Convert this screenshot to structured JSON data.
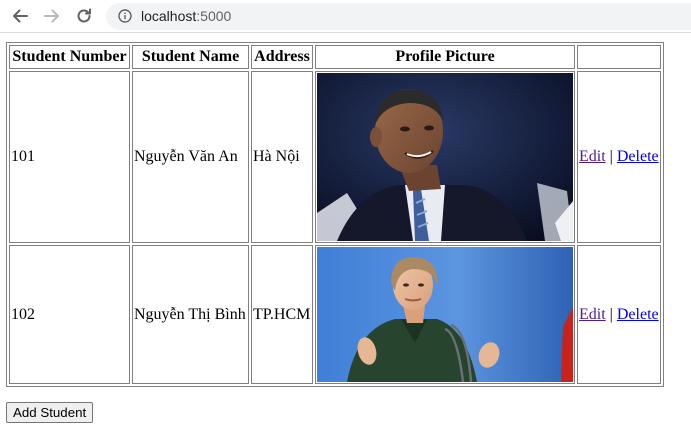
{
  "browser": {
    "url_host": "localhost",
    "url_port": ":5000"
  },
  "table": {
    "headers": {
      "number": "Student Number",
      "name": "Student Name",
      "address": "Address",
      "picture": "Profile Picture",
      "actions": ""
    },
    "rows": [
      {
        "number": "101",
        "name": "Nguyễn Văn An",
        "address": "Hà Nội",
        "edit_label": "Edit",
        "separator": "|",
        "delete_label": "Delete"
      },
      {
        "number": "102",
        "name": "Nguyễn Thị Bình",
        "address": "TP.HCM",
        "edit_label": "Edit",
        "separator": "|",
        "delete_label": "Delete"
      }
    ]
  },
  "add_button_label": "Add Student",
  "colors": {
    "link": "#0000ee",
    "visited_link": "#551a8b",
    "omnibox_bg": "#f1f3f4"
  }
}
